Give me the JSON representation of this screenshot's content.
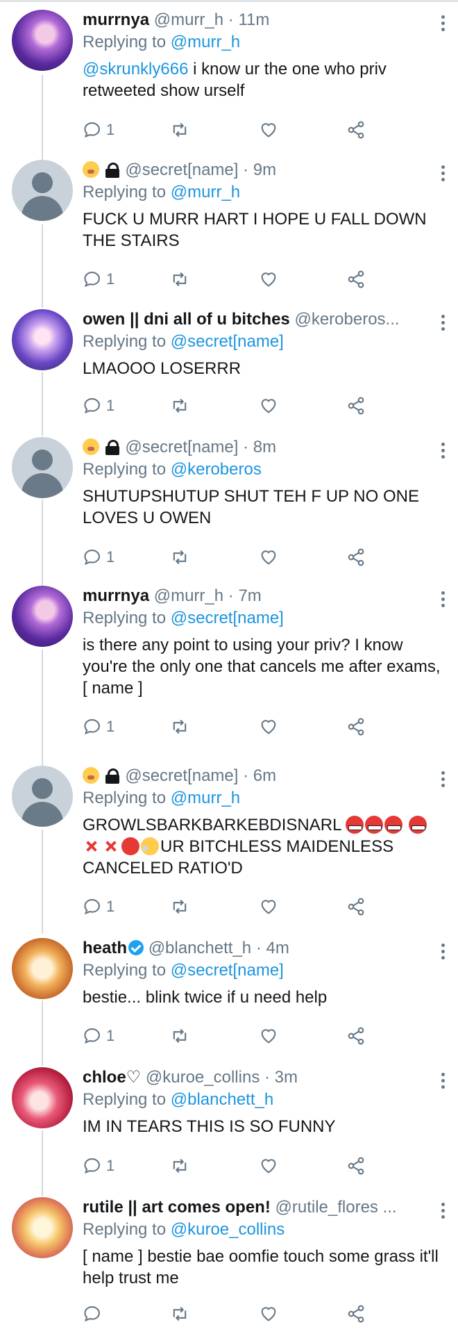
{
  "tweets": [
    {
      "avatar": "anime-avatar-purple-hair",
      "name": "murrnya",
      "handle": "@murr_h",
      "time": "11m",
      "reply_prefix": "Replying to ",
      "reply_to": "@murr_h",
      "mention": "@skrunkly666",
      "text": " i know ur the one who priv retweeted show urself",
      "reply_count": "1"
    },
    {
      "avatar": "default-avatar",
      "handle": "@secret[name]",
      "time": "9m",
      "reply_prefix": "Replying to ",
      "reply_to": "@murr_h",
      "text": "FUCK U MURR HART I HOPE U FALL DOWN THE STAIRS",
      "reply_count": "1"
    },
    {
      "avatar": "anime-avatar-white-hair",
      "name": "owen || dni all of u bitches",
      "handle": "@keroberos...",
      "reply_prefix": "Replying to ",
      "reply_to": "@secret[name]",
      "text": "LMAOOO LOSERRR",
      "reply_count": "1"
    },
    {
      "avatar": "default-avatar",
      "handle": "@secret[name]",
      "time": "8m",
      "reply_prefix": "Replying to ",
      "reply_to": "@keroberos",
      "text": "SHUTUPSHUTUP SHUT TEH F UP NO ONE LOVES U OWEN",
      "reply_count": "1"
    },
    {
      "avatar": "anime-avatar-purple-hair",
      "name": "murrnya",
      "handle": "@murr_h",
      "time": "7m",
      "reply_prefix": "Replying to ",
      "reply_to": "@secret[name]",
      "text": "is there any point to using your priv? I know you're the only one that cancels me after exams, [ name ]",
      "reply_count": "1"
    },
    {
      "avatar": "default-avatar",
      "handle": "@secret[name]",
      "time": "6m",
      "reply_prefix": "Replying to ",
      "reply_to": "@murr_h",
      "text_a": "GROWLSBARKBARKEBDISNARL ",
      "text_b": "UR BITCHLESS MAIDENLESS CANCELED RATIO'D",
      "reply_count": "1"
    },
    {
      "avatar": "anime-avatar-orange-hair",
      "name": "heath",
      "handle": "@blanchett_h",
      "time": "4m",
      "reply_prefix": "Replying to ",
      "reply_to": "@secret[name]",
      "text": "bestie... blink twice if u need help",
      "reply_count": "1"
    },
    {
      "avatar": "anime-avatar-red-hair",
      "name": "chloe♡",
      "handle": "@kuroe_collins",
      "time": "3m",
      "reply_prefix": "Replying to ",
      "reply_to": "@blanchett_h",
      "text": "IM IN TEARS THIS IS SO FUNNY",
      "reply_count": "1"
    },
    {
      "avatar": "anime-avatar-blonde-hair",
      "name": "rutile || art comes open!",
      "handle": "@rutile_flores ...",
      "reply_prefix": "Replying to ",
      "reply_to": "@kuroe_collins",
      "text": "[ name ] bestie bae oomfie touch some grass it'll help trust me"
    }
  ],
  "separator": "·",
  "colors": {
    "link": "#1b95e0",
    "muted": "#657786",
    "text": "#14171a"
  }
}
